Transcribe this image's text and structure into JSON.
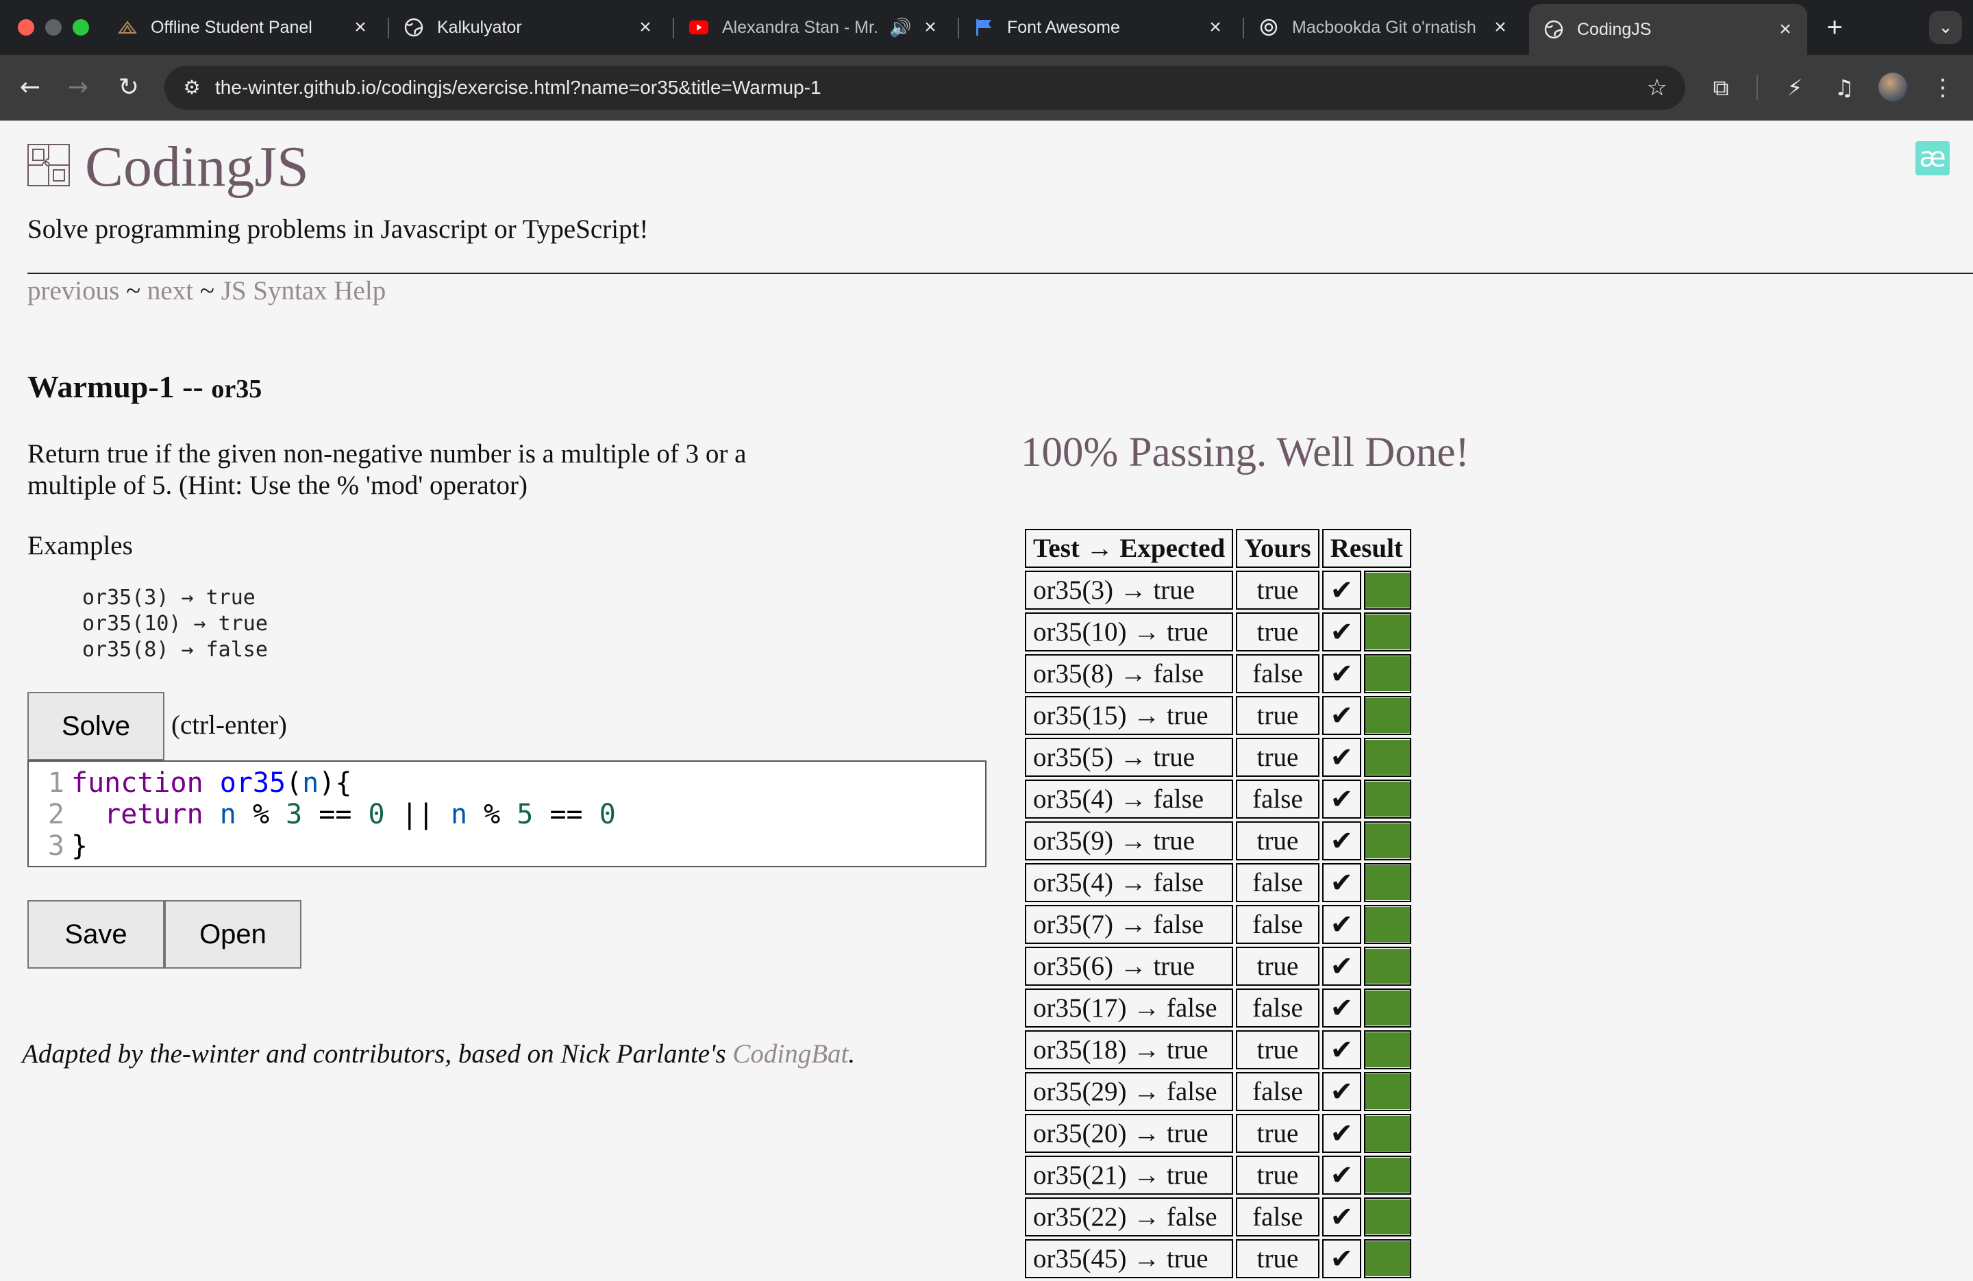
{
  "browser": {
    "tabs": [
      {
        "title": "Offline Student Panel",
        "icon": "feather-logo-icon",
        "active": false
      },
      {
        "title": "Kalkulyator",
        "icon": "globe-icon",
        "active": false
      },
      {
        "title": "Alexandra Stan - Mr.",
        "icon": "youtube-icon",
        "active": false,
        "audio": true
      },
      {
        "title": "Font Awesome",
        "icon": "flag-icon",
        "active": false
      },
      {
        "title": "Macbookda Git o'rnatish",
        "icon": "openai-icon",
        "active": false
      },
      {
        "title": "CodingJS",
        "icon": "globe-icon",
        "active": true
      }
    ],
    "url": "the-winter.github.io/codingjs/exercise.html?name=or35&title=Warmup-1"
  },
  "site": {
    "name": "CodingJS",
    "tagline": "Solve programming problems in Javascript or TypeScript!",
    "nav": {
      "previous": "previous",
      "sep": " ~ ",
      "next": "next",
      "help": "JS Syntax Help"
    }
  },
  "problem": {
    "category": "Warmup-1 -- ",
    "name": "or35",
    "description": "Return true if the given non-negative number is a multiple of 3 or a multiple of 5. (Hint: Use the % 'mod' operator)",
    "examples_label": "Examples",
    "examples": [
      "or35(3) → true",
      "or35(10) → true",
      "or35(8) → false"
    ],
    "solve_label": "Solve",
    "solve_hint": "(ctrl-enter)",
    "save_label": "Save",
    "open_label": "Open"
  },
  "editor": {
    "line_numbers": [
      "1",
      "2",
      "3"
    ]
  },
  "results": {
    "status": "100% Passing. Well Done!",
    "headers": {
      "test": "Test → Expected",
      "yours": "Yours",
      "result": "Result"
    },
    "pass_color": "#4e8a2a",
    "rows": [
      {
        "test": "or35(3) → true",
        "yours": "true"
      },
      {
        "test": "or35(10) → true",
        "yours": "true"
      },
      {
        "test": "or35(8) → false",
        "yours": "false"
      },
      {
        "test": "or35(15) → true",
        "yours": "true"
      },
      {
        "test": "or35(5) → true",
        "yours": "true"
      },
      {
        "test": "or35(4) → false",
        "yours": "false"
      },
      {
        "test": "or35(9) → true",
        "yours": "true"
      },
      {
        "test": "or35(4) → false",
        "yours": "false"
      },
      {
        "test": "or35(7) → false",
        "yours": "false"
      },
      {
        "test": "or35(6) → true",
        "yours": "true"
      },
      {
        "test": "or35(17) → false",
        "yours": "false"
      },
      {
        "test": "or35(18) → true",
        "yours": "true"
      },
      {
        "test": "or35(29) → false",
        "yours": "false"
      },
      {
        "test": "or35(20) → true",
        "yours": "true"
      },
      {
        "test": "or35(21) → true",
        "yours": "true"
      },
      {
        "test": "or35(22) → false",
        "yours": "false"
      },
      {
        "test": "or35(45) → true",
        "yours": "true"
      }
    ],
    "check_mark": "✔"
  },
  "footer": {
    "text": "Adapted by the-winter and contributors, based on Nick Parlante's ",
    "link": "CodingBat",
    "end": "."
  }
}
